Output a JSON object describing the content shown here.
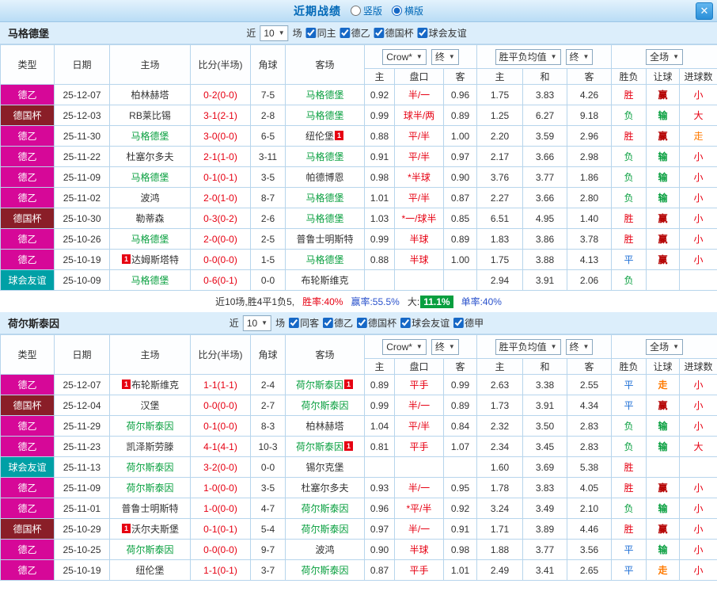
{
  "topbar": {
    "title": "近期战绩",
    "vertical_label": "竖版",
    "horizontal_label": "横版",
    "close_label": "✕",
    "chevron": "▼"
  },
  "filter": {
    "near": "近",
    "count": "10",
    "games": "场"
  },
  "columns": {
    "type": "类型",
    "date": "日期",
    "home": "主场",
    "score": "比分(半场)",
    "corner": "角球",
    "away": "客场",
    "odds_company_dd": "Crow*",
    "final_dd": "终",
    "avg_dd": "胜平负均值",
    "scope_dd": "全场",
    "odds_sub": [
      "主",
      "盘口",
      "客"
    ],
    "avg_sub": [
      "主",
      "和",
      "客"
    ],
    "result_sub": [
      "胜负",
      "让球",
      "进球数"
    ]
  },
  "colors": {
    "accent_blue": "#0068b7",
    "league_de2": "#d60898",
    "league_cup": "#8a1e28",
    "league_friendly": "#00a0a6",
    "team_green": "#089f3f",
    "score_red": "#e60012",
    "draw_blue": "#1e6fd6",
    "push_orange": "#ff7a00"
  },
  "sections": [
    {
      "team": "马格德堡",
      "checkboxes": [
        "同主",
        "德乙",
        "德国杯",
        "球会友谊"
      ],
      "rows": [
        {
          "league": "德乙",
          "lc": "de2",
          "date": "25-12-07",
          "home": {
            "n": "柏林赫塔"
          },
          "score": "0-2(0-0)",
          "corner": "7-5",
          "away": {
            "n": "马格德堡",
            "t": true
          },
          "o": [
            "0.92",
            "半/一",
            "0.96"
          ],
          "v": [
            "1.75",
            "3.83",
            "4.26"
          ],
          "r": [
            [
              "胜",
              "win"
            ],
            [
              "赢",
              "hwin"
            ],
            [
              "小",
              "small"
            ]
          ]
        },
        {
          "league": "德国杯",
          "lc": "cup",
          "date": "25-12-03",
          "home": {
            "n": "RB莱比锡"
          },
          "score": "3-1(2-1)",
          "corner": "2-8",
          "away": {
            "n": "马格德堡",
            "t": true
          },
          "o": [
            "0.99",
            "球半/两",
            "0.89"
          ],
          "v": [
            "1.25",
            "6.27",
            "9.18"
          ],
          "r": [
            [
              "负",
              "lose"
            ],
            [
              "输",
              "hlose"
            ],
            [
              "大",
              "big"
            ]
          ]
        },
        {
          "league": "德乙",
          "lc": "de2",
          "date": "25-11-30",
          "home": {
            "n": "马格德堡",
            "t": true
          },
          "score": "3-0(0-0)",
          "corner": "6-5",
          "away": {
            "n": "纽伦堡",
            "ra": "1"
          },
          "o": [
            "0.88",
            "平/半",
            "1.00"
          ],
          "v": [
            "2.20",
            "3.59",
            "2.96"
          ],
          "r": [
            [
              "胜",
              "win"
            ],
            [
              "赢",
              "hwin"
            ],
            [
              "走",
              "push"
            ]
          ]
        },
        {
          "league": "德乙",
          "lc": "de2",
          "date": "25-11-22",
          "home": {
            "n": "杜塞尔多夫"
          },
          "score": "2-1(1-0)",
          "corner": "3-11",
          "away": {
            "n": "马格德堡",
            "t": true
          },
          "o": [
            "0.91",
            "平/半",
            "0.97"
          ],
          "v": [
            "2.17",
            "3.66",
            "2.98"
          ],
          "r": [
            [
              "负",
              "lose"
            ],
            [
              "输",
              "hlose"
            ],
            [
              "小",
              "small"
            ]
          ]
        },
        {
          "league": "德乙",
          "lc": "de2",
          "date": "25-11-09",
          "home": {
            "n": "马格德堡",
            "t": true
          },
          "score": "0-1(0-1)",
          "corner": "3-5",
          "away": {
            "n": "帕德博恩"
          },
          "o": [
            "0.98",
            "*半球",
            "0.90"
          ],
          "v": [
            "3.76",
            "3.77",
            "1.86"
          ],
          "r": [
            [
              "负",
              "lose"
            ],
            [
              "输",
              "hlose"
            ],
            [
              "小",
              "small"
            ]
          ]
        },
        {
          "league": "德乙",
          "lc": "de2",
          "date": "25-11-02",
          "home": {
            "n": "波鸿"
          },
          "score": "2-0(1-0)",
          "corner": "8-7",
          "away": {
            "n": "马格德堡",
            "t": true
          },
          "o": [
            "1.01",
            "平/半",
            "0.87"
          ],
          "v": [
            "2.27",
            "3.66",
            "2.80"
          ],
          "r": [
            [
              "负",
              "lose"
            ],
            [
              "输",
              "hlose"
            ],
            [
              "小",
              "small"
            ]
          ]
        },
        {
          "league": "德国杯",
          "lc": "cup",
          "date": "25-10-30",
          "home": {
            "n": "勒蒂森"
          },
          "score": "0-3(0-2)",
          "corner": "2-6",
          "away": {
            "n": "马格德堡",
            "t": true
          },
          "o": [
            "1.03",
            "*一/球半",
            "0.85"
          ],
          "v": [
            "6.51",
            "4.95",
            "1.40"
          ],
          "r": [
            [
              "胜",
              "win"
            ],
            [
              "赢",
              "hwin"
            ],
            [
              "小",
              "small"
            ]
          ]
        },
        {
          "league": "德乙",
          "lc": "de2",
          "date": "25-10-26",
          "home": {
            "n": "马格德堡",
            "t": true
          },
          "score": "2-0(0-0)",
          "corner": "2-5",
          "away": {
            "n": "普鲁士明斯特"
          },
          "o": [
            "0.99",
            "半球",
            "0.89"
          ],
          "v": [
            "1.83",
            "3.86",
            "3.78"
          ],
          "r": [
            [
              "胜",
              "win"
            ],
            [
              "赢",
              "hwin"
            ],
            [
              "小",
              "small"
            ]
          ]
        },
        {
          "league": "德乙",
          "lc": "de2",
          "date": "25-10-19",
          "home": {
            "n": "达姆斯塔特",
            "rb": "1"
          },
          "score": "0-0(0-0)",
          "corner": "1-5",
          "away": {
            "n": "马格德堡",
            "t": true
          },
          "o": [
            "0.88",
            "半球",
            "1.00"
          ],
          "v": [
            "1.75",
            "3.88",
            "4.13"
          ],
          "r": [
            [
              "平",
              "draw"
            ],
            [
              "赢",
              "hwin"
            ],
            [
              "小",
              "small"
            ]
          ]
        },
        {
          "league": "球会友谊",
          "lc": "fr",
          "date": "25-10-09",
          "home": {
            "n": "马格德堡",
            "t": true
          },
          "score": "0-6(0-1)",
          "corner": "0-0",
          "away": {
            "n": "布轮斯维克"
          },
          "o": [
            "",
            "",
            ""
          ],
          "v": [
            "2.94",
            "3.91",
            "2.06"
          ],
          "r": [
            [
              "负",
              "lose"
            ],
            [
              "",
              ""
            ],
            [
              "",
              ""
            ]
          ]
        }
      ],
      "summary": {
        "record": "近10场,胜4平1负5,",
        "win_rate": "胜率:40%",
        "handicap_rate": "赢率:55.5%",
        "big_label": "大:",
        "big_value": "11.1%",
        "single_rate": "单率:40%"
      }
    },
    {
      "team": "荷尔斯泰因",
      "checkboxes": [
        "同客",
        "德乙",
        "德国杯",
        "球会友谊",
        "德甲"
      ],
      "rows": [
        {
          "league": "德乙",
          "lc": "de2",
          "date": "25-12-07",
          "home": {
            "n": "布轮斯维克",
            "rb": "1"
          },
          "score": "1-1(1-1)",
          "corner": "2-4",
          "away": {
            "n": "荷尔斯泰因",
            "t": true,
            "ra": "1"
          },
          "o": [
            "0.89",
            "平手",
            "0.99"
          ],
          "v": [
            "2.63",
            "3.38",
            "2.55"
          ],
          "r": [
            [
              "平",
              "draw"
            ],
            [
              "走",
              "hpush"
            ],
            [
              "小",
              "small"
            ]
          ]
        },
        {
          "league": "德国杯",
          "lc": "cup",
          "date": "25-12-04",
          "home": {
            "n": "汉堡"
          },
          "score": "0-0(0-0)",
          "corner": "2-7",
          "away": {
            "n": "荷尔斯泰因",
            "t": true
          },
          "o": [
            "0.99",
            "半/一",
            "0.89"
          ],
          "v": [
            "1.73",
            "3.91",
            "4.34"
          ],
          "r": [
            [
              "平",
              "draw"
            ],
            [
              "赢",
              "hwin"
            ],
            [
              "小",
              "small"
            ]
          ]
        },
        {
          "league": "德乙",
          "lc": "de2",
          "date": "25-11-29",
          "home": {
            "n": "荷尔斯泰因",
            "t": true
          },
          "score": "0-1(0-0)",
          "corner": "8-3",
          "away": {
            "n": "柏林赫塔"
          },
          "o": [
            "1.04",
            "平/半",
            "0.84"
          ],
          "v": [
            "2.32",
            "3.50",
            "2.83"
          ],
          "r": [
            [
              "负",
              "lose"
            ],
            [
              "输",
              "hlose"
            ],
            [
              "小",
              "small"
            ]
          ]
        },
        {
          "league": "德乙",
          "lc": "de2",
          "date": "25-11-23",
          "home": {
            "n": "凯泽斯劳滕"
          },
          "score": "4-1(4-1)",
          "corner": "10-3",
          "away": {
            "n": "荷尔斯泰因",
            "t": true,
            "ra": "1"
          },
          "o": [
            "0.81",
            "平手",
            "1.07"
          ],
          "v": [
            "2.34",
            "3.45",
            "2.83"
          ],
          "r": [
            [
              "负",
              "lose"
            ],
            [
              "输",
              "hlose"
            ],
            [
              "大",
              "big"
            ]
          ]
        },
        {
          "league": "球会友谊",
          "lc": "fr",
          "date": "25-11-13",
          "home": {
            "n": "荷尔斯泰因",
            "t": true
          },
          "score": "3-2(0-0)",
          "corner": "0-0",
          "away": {
            "n": "锡尔克堡"
          },
          "o": [
            "",
            "",
            ""
          ],
          "v": [
            "1.60",
            "3.69",
            "5.38"
          ],
          "r": [
            [
              "胜",
              "win"
            ],
            [
              "",
              ""
            ],
            [
              "",
              ""
            ]
          ]
        },
        {
          "league": "德乙",
          "lc": "de2",
          "date": "25-11-09",
          "home": {
            "n": "荷尔斯泰因",
            "t": true
          },
          "score": "1-0(0-0)",
          "corner": "3-5",
          "away": {
            "n": "杜塞尔多夫"
          },
          "o": [
            "0.93",
            "半/一",
            "0.95"
          ],
          "v": [
            "1.78",
            "3.83",
            "4.05"
          ],
          "r": [
            [
              "胜",
              "win"
            ],
            [
              "赢",
              "hwin"
            ],
            [
              "小",
              "small"
            ]
          ]
        },
        {
          "league": "德乙",
          "lc": "de2",
          "date": "25-11-01",
          "home": {
            "n": "普鲁士明斯特"
          },
          "score": "1-0(0-0)",
          "corner": "4-7",
          "away": {
            "n": "荷尔斯泰因",
            "t": true
          },
          "o": [
            "0.96",
            "*平/半",
            "0.92"
          ],
          "v": [
            "3.24",
            "3.49",
            "2.10"
          ],
          "r": [
            [
              "负",
              "lose"
            ],
            [
              "输",
              "hlose"
            ],
            [
              "小",
              "small"
            ]
          ]
        },
        {
          "league": "德国杯",
          "lc": "cup",
          "date": "25-10-29",
          "home": {
            "n": "沃尔夫斯堡",
            "rb": "1"
          },
          "score": "0-1(0-1)",
          "corner": "5-4",
          "away": {
            "n": "荷尔斯泰因",
            "t": true
          },
          "o": [
            "0.97",
            "半/一",
            "0.91"
          ],
          "v": [
            "1.71",
            "3.89",
            "4.46"
          ],
          "r": [
            [
              "胜",
              "win"
            ],
            [
              "赢",
              "hwin"
            ],
            [
              "小",
              "small"
            ]
          ]
        },
        {
          "league": "德乙",
          "lc": "de2",
          "date": "25-10-25",
          "home": {
            "n": "荷尔斯泰因",
            "t": true
          },
          "score": "0-0(0-0)",
          "corner": "9-7",
          "away": {
            "n": "波鸿"
          },
          "o": [
            "0.90",
            "半球",
            "0.98"
          ],
          "v": [
            "1.88",
            "3.77",
            "3.56"
          ],
          "r": [
            [
              "平",
              "draw"
            ],
            [
              "输",
              "hlose"
            ],
            [
              "小",
              "small"
            ]
          ]
        },
        {
          "league": "德乙",
          "lc": "de2",
          "date": "25-10-19",
          "home": {
            "n": "纽伦堡"
          },
          "score": "1-1(0-1)",
          "corner": "3-7",
          "away": {
            "n": "荷尔斯泰因",
            "t": true
          },
          "o": [
            "0.87",
            "平手",
            "1.01"
          ],
          "v": [
            "2.49",
            "3.41",
            "2.65"
          ],
          "r": [
            [
              "平",
              "draw"
            ],
            [
              "走",
              "hpush"
            ],
            [
              "小",
              "small"
            ]
          ]
        }
      ]
    }
  ]
}
